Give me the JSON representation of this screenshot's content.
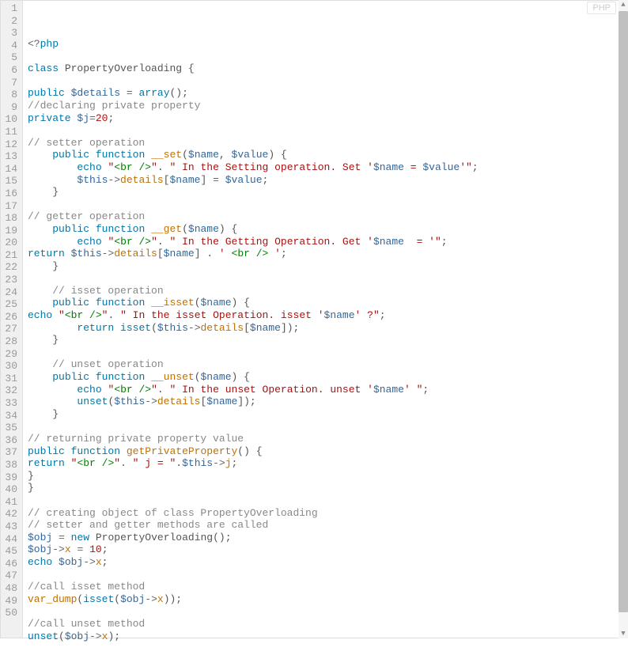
{
  "badge": "PHP",
  "lines": [
    [
      [
        "op",
        "<?"
      ],
      [
        "kw",
        "php"
      ]
    ],
    [],
    [
      [
        "kw",
        "class"
      ],
      [
        "pn",
        " "
      ],
      [
        "cls",
        "PropertyOverloading"
      ],
      [
        "pn",
        " {"
      ]
    ],
    [],
    [
      [
        "kw",
        "public"
      ],
      [
        "pn",
        " "
      ],
      [
        "var",
        "$details"
      ],
      [
        "pn",
        " "
      ],
      [
        "op",
        "="
      ],
      [
        "pn",
        " "
      ],
      [
        "kw",
        "array"
      ],
      [
        "pn",
        "();"
      ]
    ],
    [
      [
        "cmt",
        "//declaring private property"
      ]
    ],
    [
      [
        "kw",
        "private"
      ],
      [
        "pn",
        " "
      ],
      [
        "var",
        "$j"
      ],
      [
        "op",
        "="
      ],
      [
        "num",
        "20"
      ],
      [
        "pn",
        ";"
      ]
    ],
    [],
    [
      [
        "cmt",
        "// setter operation"
      ]
    ],
    [
      [
        "pn",
        "    "
      ],
      [
        "kw",
        "public"
      ],
      [
        "pn",
        " "
      ],
      [
        "kw",
        "function"
      ],
      [
        "pn",
        " "
      ],
      [
        "fn",
        "__set"
      ],
      [
        "pn",
        "("
      ],
      [
        "var",
        "$name"
      ],
      [
        "pn",
        ", "
      ],
      [
        "var",
        "$value"
      ],
      [
        "pn",
        ") {"
      ]
    ],
    [
      [
        "pn",
        "        "
      ],
      [
        "kw",
        "echo"
      ],
      [
        "pn",
        " "
      ],
      [
        "str",
        "\""
      ],
      [
        "tag",
        "<br />"
      ],
      [
        "str",
        "\""
      ],
      [
        "pn",
        ". "
      ],
      [
        "str",
        "\" In the Setting operation. Set '"
      ],
      [
        "var",
        "$name"
      ],
      [
        "str",
        " = "
      ],
      [
        "var",
        "$value"
      ],
      [
        "str",
        "'\""
      ],
      [
        "pn",
        ";"
      ]
    ],
    [
      [
        "pn",
        "        "
      ],
      [
        "var",
        "$this"
      ],
      [
        "op",
        "->"
      ],
      [
        "fn",
        "details"
      ],
      [
        "pn",
        "["
      ],
      [
        "var",
        "$name"
      ],
      [
        "pn",
        "] "
      ],
      [
        "op",
        "="
      ],
      [
        "pn",
        " "
      ],
      [
        "var",
        "$value"
      ],
      [
        "pn",
        ";"
      ]
    ],
    [
      [
        "pn",
        "    }"
      ]
    ],
    [],
    [
      [
        "cmt",
        "// getter operation"
      ]
    ],
    [
      [
        "pn",
        "    "
      ],
      [
        "kw",
        "public"
      ],
      [
        "pn",
        " "
      ],
      [
        "kw",
        "function"
      ],
      [
        "pn",
        " "
      ],
      [
        "fn",
        "__get"
      ],
      [
        "pn",
        "("
      ],
      [
        "var",
        "$name"
      ],
      [
        "pn",
        ") {"
      ]
    ],
    [
      [
        "pn",
        "        "
      ],
      [
        "kw",
        "echo"
      ],
      [
        "pn",
        " "
      ],
      [
        "str",
        "\""
      ],
      [
        "tag",
        "<br />"
      ],
      [
        "str",
        "\""
      ],
      [
        "pn",
        ". "
      ],
      [
        "str",
        "\" In the Getting Operation. Get '"
      ],
      [
        "var",
        "$name"
      ],
      [
        "str",
        "  = '\""
      ],
      [
        "pn",
        ";"
      ]
    ],
    [
      [
        "kw",
        "return"
      ],
      [
        "pn",
        " "
      ],
      [
        "var",
        "$this"
      ],
      [
        "op",
        "->"
      ],
      [
        "fn",
        "details"
      ],
      [
        "pn",
        "["
      ],
      [
        "var",
        "$name"
      ],
      [
        "pn",
        "] . "
      ],
      [
        "str",
        "' "
      ],
      [
        "tag",
        "<br />"
      ],
      [
        "str",
        " '"
      ],
      [
        "pn",
        ";"
      ]
    ],
    [
      [
        "pn",
        "    }"
      ]
    ],
    [],
    [
      [
        "pn",
        "    "
      ],
      [
        "cmt",
        "// isset operation"
      ]
    ],
    [
      [
        "pn",
        "    "
      ],
      [
        "kw",
        "public"
      ],
      [
        "pn",
        " "
      ],
      [
        "kw",
        "function"
      ],
      [
        "pn",
        " "
      ],
      [
        "fn",
        "__isset"
      ],
      [
        "pn",
        "("
      ],
      [
        "var",
        "$name"
      ],
      [
        "pn",
        ") {"
      ]
    ],
    [
      [
        "kw",
        "echo"
      ],
      [
        "pn",
        " "
      ],
      [
        "str",
        "\""
      ],
      [
        "tag",
        "<br />"
      ],
      [
        "str",
        "\""
      ],
      [
        "pn",
        ". "
      ],
      [
        "str",
        "\" In the isset Operation. isset '"
      ],
      [
        "var",
        "$name"
      ],
      [
        "str",
        "' ?\""
      ],
      [
        "pn",
        ";"
      ]
    ],
    [
      [
        "pn",
        "        "
      ],
      [
        "kw",
        "return"
      ],
      [
        "pn",
        " "
      ],
      [
        "kw",
        "isset"
      ],
      [
        "pn",
        "("
      ],
      [
        "var",
        "$this"
      ],
      [
        "op",
        "->"
      ],
      [
        "fn",
        "details"
      ],
      [
        "pn",
        "["
      ],
      [
        "var",
        "$name"
      ],
      [
        "pn",
        "]);"
      ]
    ],
    [
      [
        "pn",
        "    }"
      ]
    ],
    [],
    [
      [
        "pn",
        "    "
      ],
      [
        "cmt",
        "// unset operation"
      ]
    ],
    [
      [
        "pn",
        "    "
      ],
      [
        "kw",
        "public"
      ],
      [
        "pn",
        " "
      ],
      [
        "kw",
        "function"
      ],
      [
        "pn",
        " "
      ],
      [
        "fn",
        "__unset"
      ],
      [
        "pn",
        "("
      ],
      [
        "var",
        "$name"
      ],
      [
        "pn",
        ") {"
      ]
    ],
    [
      [
        "pn",
        "        "
      ],
      [
        "kw",
        "echo"
      ],
      [
        "pn",
        " "
      ],
      [
        "str",
        "\""
      ],
      [
        "tag",
        "<br />"
      ],
      [
        "str",
        "\""
      ],
      [
        "pn",
        ". "
      ],
      [
        "str",
        "\" In the unset Operation. unset '"
      ],
      [
        "var",
        "$name"
      ],
      [
        "str",
        "' \""
      ],
      [
        "pn",
        ";"
      ]
    ],
    [
      [
        "pn",
        "        "
      ],
      [
        "kw",
        "unset"
      ],
      [
        "pn",
        "("
      ],
      [
        "var",
        "$this"
      ],
      [
        "op",
        "->"
      ],
      [
        "fn",
        "details"
      ],
      [
        "pn",
        "["
      ],
      [
        "var",
        "$name"
      ],
      [
        "pn",
        "]);"
      ]
    ],
    [
      [
        "pn",
        "    }"
      ]
    ],
    [],
    [
      [
        "cmt",
        "// returning private property value"
      ]
    ],
    [
      [
        "kw",
        "public"
      ],
      [
        "pn",
        " "
      ],
      [
        "kw",
        "function"
      ],
      [
        "pn",
        " "
      ],
      [
        "fn",
        "getPrivateProperty"
      ],
      [
        "pn",
        "() {"
      ]
    ],
    [
      [
        "kw",
        "return"
      ],
      [
        "pn",
        " "
      ],
      [
        "str",
        "\""
      ],
      [
        "tag",
        "<br />"
      ],
      [
        "str",
        "\""
      ],
      [
        "pn",
        ". "
      ],
      [
        "str",
        "\" j = \""
      ],
      [
        "pn",
        "."
      ],
      [
        "var",
        "$this"
      ],
      [
        "op",
        "->"
      ],
      [
        "fn",
        "j"
      ],
      [
        "pn",
        ";"
      ]
    ],
    [
      [
        "pn",
        "}"
      ]
    ],
    [
      [
        "pn",
        "}"
      ]
    ],
    [],
    [
      [
        "cmt",
        "// creating object of class PropertyOverloading"
      ]
    ],
    [
      [
        "cmt",
        "// setter and getter methods are called"
      ]
    ],
    [
      [
        "var",
        "$obj"
      ],
      [
        "pn",
        " "
      ],
      [
        "op",
        "="
      ],
      [
        "pn",
        " "
      ],
      [
        "kw",
        "new"
      ],
      [
        "pn",
        " "
      ],
      [
        "cls",
        "PropertyOverloading"
      ],
      [
        "pn",
        "();"
      ]
    ],
    [
      [
        "var",
        "$obj"
      ],
      [
        "op",
        "->"
      ],
      [
        "fn",
        "x"
      ],
      [
        "pn",
        " "
      ],
      [
        "op",
        "="
      ],
      [
        "pn",
        " "
      ],
      [
        "num",
        "10"
      ],
      [
        "pn",
        ";"
      ]
    ],
    [
      [
        "kw",
        "echo"
      ],
      [
        "pn",
        " "
      ],
      [
        "var",
        "$obj"
      ],
      [
        "op",
        "->"
      ],
      [
        "fn",
        "x"
      ],
      [
        "pn",
        ";"
      ]
    ],
    [],
    [
      [
        "cmt",
        "//call isset method"
      ]
    ],
    [
      [
        "fn",
        "var_dump"
      ],
      [
        "pn",
        "("
      ],
      [
        "kw",
        "isset"
      ],
      [
        "pn",
        "("
      ],
      [
        "var",
        "$obj"
      ],
      [
        "op",
        "->"
      ],
      [
        "fn",
        "x"
      ],
      [
        "pn",
        "));"
      ]
    ],
    [],
    [
      [
        "cmt",
        "//call unset method"
      ]
    ],
    [
      [
        "kw",
        "unset"
      ],
      [
        "pn",
        "("
      ],
      [
        "var",
        "$obj"
      ],
      [
        "op",
        "->"
      ],
      [
        "fn",
        "x"
      ],
      [
        "pn",
        ");"
      ]
    ],
    []
  ],
  "scrollbar": {
    "thumbTop": 14,
    "thumbHeight": 760
  }
}
